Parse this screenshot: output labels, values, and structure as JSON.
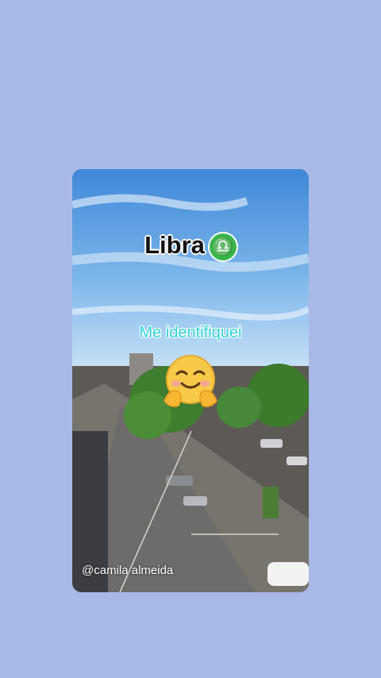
{
  "story": {
    "title": "Libra",
    "zodiac_icon": "libra-zodiac-icon",
    "zodiac_glyph": "♎",
    "subtitle": "Me identifiquei",
    "emoji_icon": "hugging-face-icon",
    "username": "@camila almeida"
  },
  "colors": {
    "page_background": "#a9b9e6",
    "title_text": "#111111",
    "subtitle_text": "#2ad1d6",
    "zodiac_badge": "#39b54a"
  }
}
